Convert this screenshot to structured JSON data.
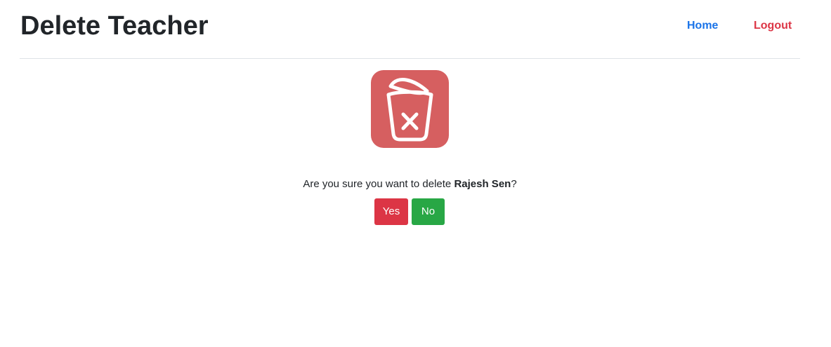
{
  "header": {
    "title": "Delete Teacher",
    "nav": {
      "home_label": "Home",
      "logout_label": "Logout"
    }
  },
  "icon": {
    "name": "trash-x-icon",
    "tile_color": "#d65f60"
  },
  "confirm": {
    "prefix": "Are you sure you want to delete ",
    "teacher_name": "Rajesh Sen",
    "suffix": "?"
  },
  "buttons": {
    "yes_label": "Yes",
    "no_label": "No"
  },
  "colors": {
    "home_link": "#1a73e8",
    "logout_link": "#dc3545",
    "yes_button": "#dc3545",
    "no_button": "#28a745"
  }
}
